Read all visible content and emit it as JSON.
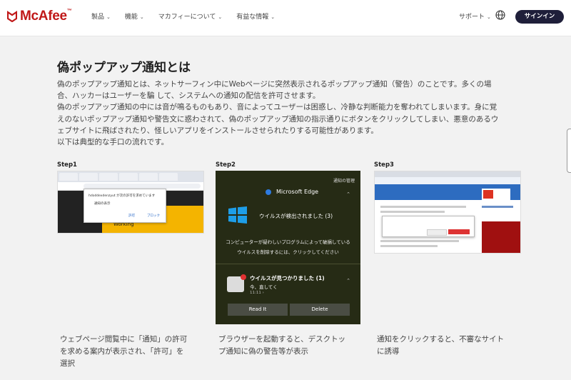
{
  "header": {
    "brand": "McAfee",
    "brand_tm": "™",
    "nav": [
      "製品",
      "機能",
      "マカフィーについて",
      "有益な情報"
    ],
    "support": "サポート",
    "signin": "サインイン"
  },
  "main": {
    "title": "偽ポップアップ通知とは",
    "paragraph": [
      "偽のポップアップ通知とは、ネットサーフィン中にWebページに突然表示されるポップアップ通知（警告）のことです。多くの場",
      "合、ハッカーはユーザーを騙 して、システムへの通知の配信を許可させます。",
      "偽のポップアップ通知の中には音が鳴るものもあり、音によってユーザーは困惑し、冷静な判断能力を奪われてしまいます。身に覚",
      "えのないポップアップ通知や警告文に惑わされて、偽のポップアップ通知の指示通りにボタンをクリックしてしまい、悪意のあるウ",
      "ェブサイトに飛ばされたり、怪しいアプリをインストールさせられたりする可能性があります。",
      "以下は典型的な手口の流れです。"
    ]
  },
  "steps": [
    {
      "label": "Step1",
      "caption": [
        "ウェブページ閲覧中に「通知」の許可",
        "を求める案内が表示され、「許可」を",
        "選択"
      ],
      "screen": {
        "popup_line1": "hdoddexdenzyut が次の許可を求めています",
        "popup_line2": "通知の表示",
        "allow": "許可",
        "block": "ブロック",
        "working": "Working"
      }
    },
    {
      "label": "Step2",
      "caption": [
        "ブラウザーを起動すると、デスクトッ",
        "プ通知に偽の警告等が表示"
      ],
      "screen": {
        "notif_mgmt": "通知の管理",
        "app": "Microsoft Edge",
        "detected": "ウイルスが検出されました (3)",
        "msg1": "コンピューターが疑わしいプログラムによって破損している",
        "msg2": "ウイルスを削除するには、クリックしてください",
        "found": "ウイルスが見つかりました (1)",
        "now": "今、直してく",
        "time": "11:11 ›",
        "read": "Read It",
        "delete": "Delete"
      }
    },
    {
      "label": "Step3",
      "caption": [
        "通知をクリックすると、不審なサイト",
        "に誘導"
      ]
    }
  ],
  "colors": {
    "brand_red": "#c01818",
    "signin_bg": "#1f1f3a",
    "step2_bg": "#262b15"
  }
}
